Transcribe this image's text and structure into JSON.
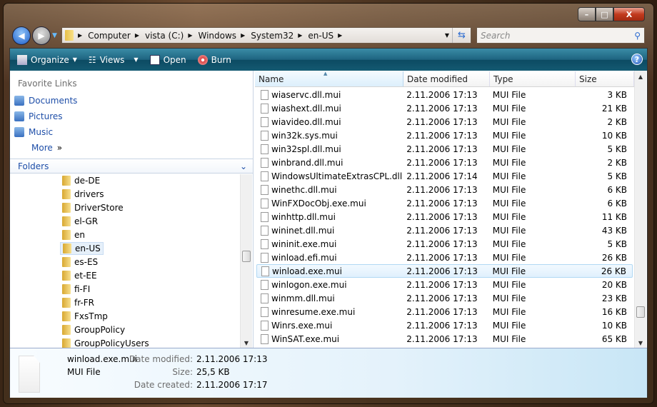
{
  "window": {
    "minimize": "–",
    "maximize": "□",
    "close": "X"
  },
  "address": {
    "crumbs": [
      "Computer",
      "vista (C:)",
      "Windows",
      "System32",
      "en-US"
    ]
  },
  "search": {
    "placeholder": "Search"
  },
  "toolbar": {
    "organize": "Organize",
    "views": "Views",
    "open": "Open",
    "burn": "Burn",
    "help": "?"
  },
  "favorites": {
    "title": "Favorite Links",
    "items": [
      {
        "label": "Documents"
      },
      {
        "label": "Pictures"
      },
      {
        "label": "Music"
      }
    ],
    "more": "More",
    "more_glyph": "»"
  },
  "folders": {
    "title": "Folders",
    "items": [
      "de-DE",
      "drivers",
      "DriverStore",
      "el-GR",
      "en",
      "en-US",
      "es-ES",
      "et-EE",
      "fi-FI",
      "fr-FR",
      "FxsTmp",
      "GroupPolicy",
      "GroupPolicyUsers"
    ],
    "selected": "en-US"
  },
  "list": {
    "columns": [
      "Name",
      "Date modified",
      "Type",
      "Size"
    ],
    "rows": [
      [
        "wiaservc.dll.mui",
        "2.11.2006 17:13",
        "MUI File",
        "3 KB"
      ],
      [
        "wiashext.dll.mui",
        "2.11.2006 17:13",
        "MUI File",
        "21 KB"
      ],
      [
        "wiavideo.dll.mui",
        "2.11.2006 17:13",
        "MUI File",
        "2 KB"
      ],
      [
        "win32k.sys.mui",
        "2.11.2006 17:13",
        "MUI File",
        "10 KB"
      ],
      [
        "win32spl.dll.mui",
        "2.11.2006 17:13",
        "MUI File",
        "5 KB"
      ],
      [
        "winbrand.dll.mui",
        "2.11.2006 17:13",
        "MUI File",
        "2 KB"
      ],
      [
        "WindowsUltimateExtrasCPL.dll....",
        "2.11.2006 17:14",
        "MUI File",
        "5 KB"
      ],
      [
        "winethc.dll.mui",
        "2.11.2006 17:13",
        "MUI File",
        "6 KB"
      ],
      [
        "WinFXDocObj.exe.mui",
        "2.11.2006 17:13",
        "MUI File",
        "6 KB"
      ],
      [
        "winhttp.dll.mui",
        "2.11.2006 17:13",
        "MUI File",
        "11 KB"
      ],
      [
        "wininet.dll.mui",
        "2.11.2006 17:13",
        "MUI File",
        "43 KB"
      ],
      [
        "wininit.exe.mui",
        "2.11.2006 17:13",
        "MUI File",
        "5 KB"
      ],
      [
        "winload.efi.mui",
        "2.11.2006 17:13",
        "MUI File",
        "26 KB"
      ],
      [
        "winload.exe.mui",
        "2.11.2006 17:13",
        "MUI File",
        "26 KB"
      ],
      [
        "winlogon.exe.mui",
        "2.11.2006 17:13",
        "MUI File",
        "20 KB"
      ],
      [
        "winmm.dll.mui",
        "2.11.2006 17:13",
        "MUI File",
        "23 KB"
      ],
      [
        "winresume.exe.mui",
        "2.11.2006 17:13",
        "MUI File",
        "16 KB"
      ],
      [
        "Winrs.exe.mui",
        "2.11.2006 17:13",
        "MUI File",
        "10 KB"
      ],
      [
        "WinSAT.exe.mui",
        "2.11.2006 17:13",
        "MUI File",
        "65 KB"
      ]
    ],
    "selected": "winload.exe.mui"
  },
  "details": {
    "name": "winload.exe.mui",
    "type": "MUI File",
    "modified_label": "Date modified:",
    "modified": "2.11.2006 17:13",
    "size_label": "Size:",
    "size": "25,5 KB",
    "created_label": "Date created:",
    "created": "2.11.2006 17:17"
  }
}
